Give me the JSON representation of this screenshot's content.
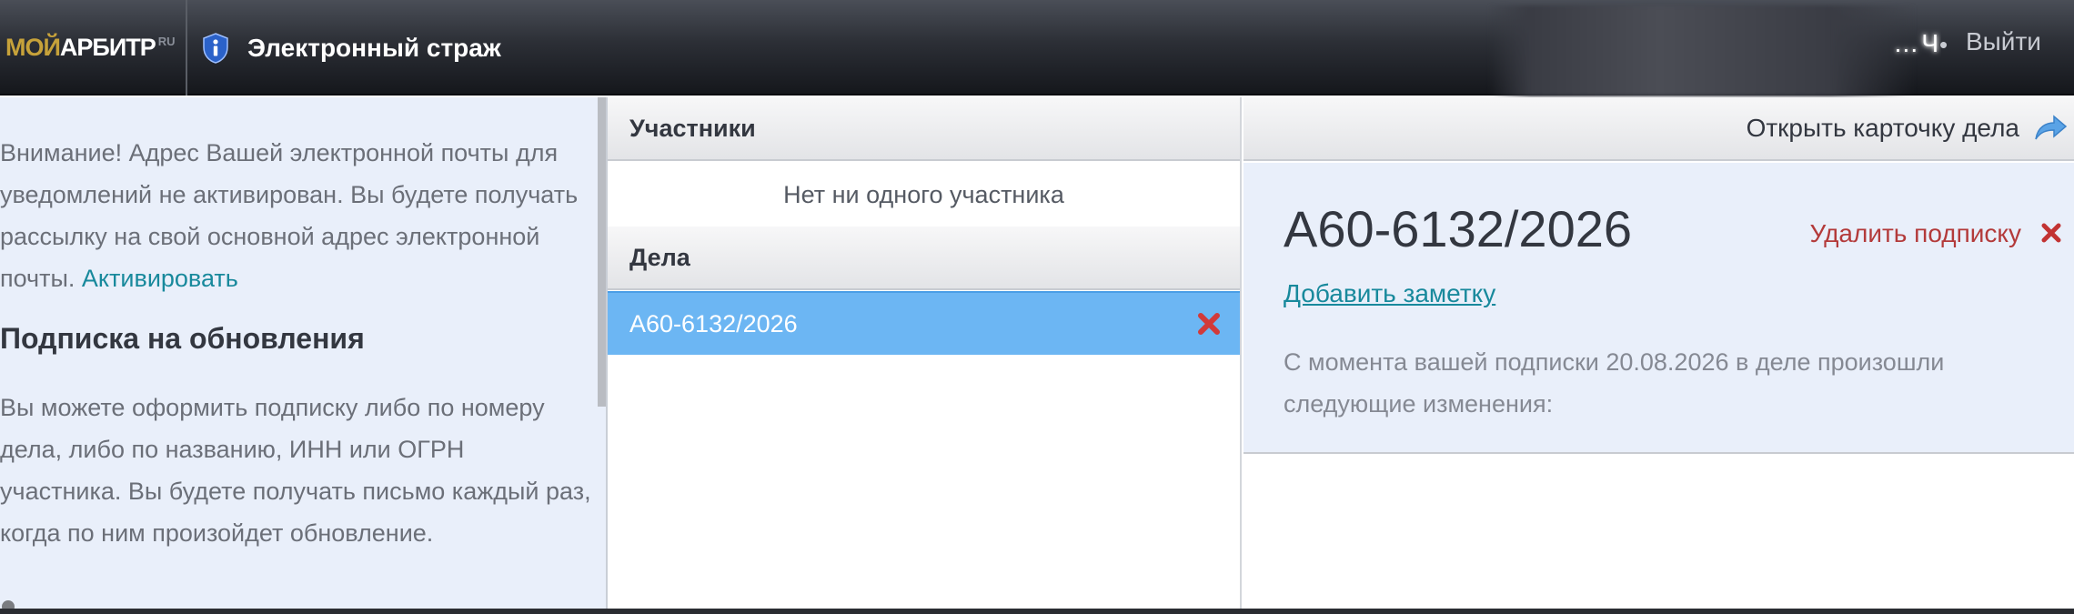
{
  "header": {
    "logo": {
      "part1": "МОЙ",
      "part2": "АРБИТР",
      "part3": "RU"
    },
    "app_title": "Электронный страж",
    "user_name": "…Ч",
    "separator": "•",
    "logout_label": "Выйти"
  },
  "left": {
    "notice_text": "Внимание! Адрес Вашей электронной почты для уведомлений не активирован. Вы будете получать рассылку на свой основной адрес электронной почты.",
    "activate_link": "Активировать",
    "subscription_title": "Подписка на обновления",
    "subscription_text": "Вы можете оформить подписку либо по номеру дела, либо по названию, ИНН или ОГРН участника. Вы будете получать письмо каждый раз, когда по ним произойдет обновление."
  },
  "middle": {
    "participants_header": "Участники",
    "participants_empty": "Нет ни одного участника",
    "cases_header": "Дела",
    "cases": [
      {
        "number": "А60-6132/2026",
        "selected": true
      }
    ]
  },
  "right": {
    "open_card_label": "Открыть карточку дела",
    "case_number": "А60-6132/2026",
    "unsubscribe_label": "Удалить подписку",
    "add_note_label": "Добавить заметку",
    "changes_text": "С момента вашей подписки 20.08.2026 в деле произошли следующие изменения:"
  },
  "icons": {
    "app": "shield-info-icon",
    "delete": "close-x-icon",
    "open_card": "arrow-forward-icon"
  },
  "colors": {
    "accent_blue": "#6cb6f3",
    "link_teal": "#18899c",
    "danger_red": "#b33a3a",
    "panel_bg": "#e9effa"
  }
}
